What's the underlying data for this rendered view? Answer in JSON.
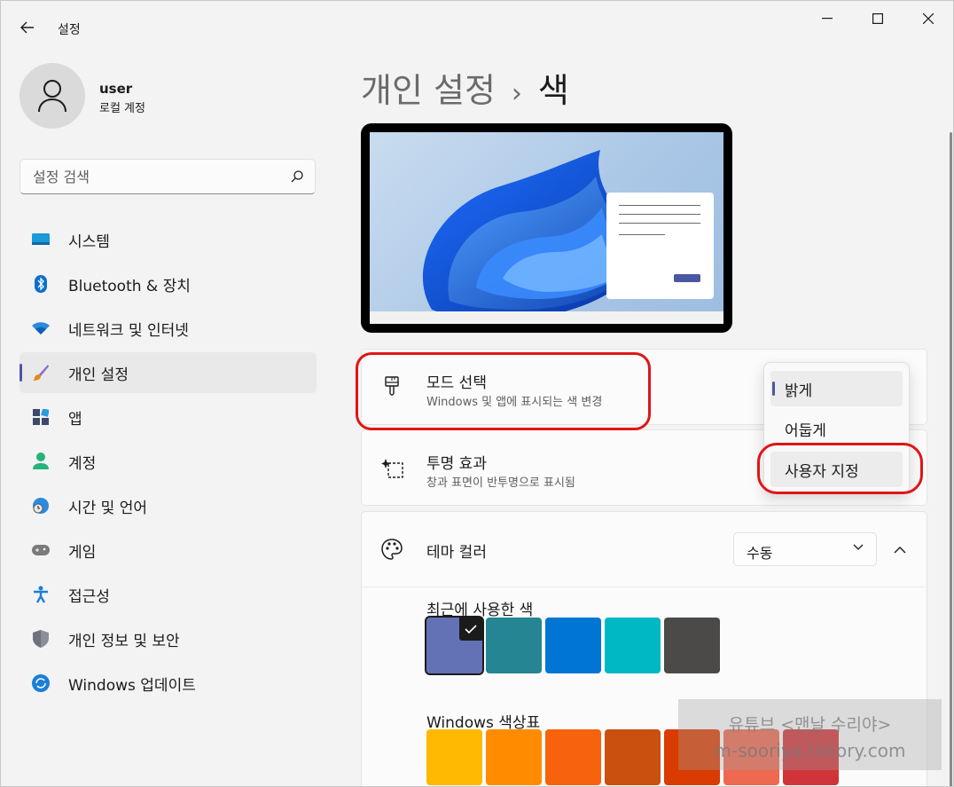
{
  "window": {
    "title": "설정"
  },
  "profile": {
    "name": "user",
    "account_type": "로컬 계정"
  },
  "search": {
    "placeholder": "설정 검색"
  },
  "sidebar": {
    "items": [
      {
        "label": "시스템",
        "icon": "system-icon"
      },
      {
        "label": "Bluetooth & 장치",
        "icon": "bluetooth-icon"
      },
      {
        "label": "네트워크 및 인터넷",
        "icon": "wifi-icon"
      },
      {
        "label": "개인 설정",
        "icon": "brush-icon",
        "active": true
      },
      {
        "label": "앱",
        "icon": "apps-icon"
      },
      {
        "label": "계정",
        "icon": "account-icon"
      },
      {
        "label": "시간 및 언어",
        "icon": "clock-globe-icon"
      },
      {
        "label": "게임",
        "icon": "gamepad-icon"
      },
      {
        "label": "접근성",
        "icon": "accessibility-icon"
      },
      {
        "label": "개인 정보 및 보안",
        "icon": "shield-icon"
      },
      {
        "label": "Windows 업데이트",
        "icon": "update-icon"
      }
    ]
  },
  "header": {
    "breadcrumb_parent": "개인 설정",
    "separator": "›",
    "current": "색"
  },
  "mode": {
    "title": "모드 선택",
    "subtitle": "Windows 및 앱에 표시되는 색 변경",
    "options": [
      "밝게",
      "어둡게",
      "사용자 지정"
    ],
    "selected": "밝게"
  },
  "transparency": {
    "title": "투명 효과",
    "subtitle": "창과 표면이 반투명으로 표시됨"
  },
  "theme_color": {
    "title": "테마 컬러",
    "select_value": "수동",
    "recent_label": "최근에 사용한 색",
    "recent_colors": [
      "#6372b4",
      "#258592",
      "#0075d3",
      "#00b8c4",
      "#4b4a48"
    ],
    "palette_label": "Windows 색상표",
    "palette_colors": [
      "#ffb900",
      "#ff8c00",
      "#f7630c",
      "#ca5010",
      "#da3b01",
      "#ef6950",
      "#d13438"
    ]
  },
  "watermark": {
    "line1": "유튜브 <맨날 수리야>",
    "line2": "m-sooriya.tistory.com"
  },
  "colors": {
    "accent": "#4a57a3",
    "highlight": "#e01515"
  }
}
